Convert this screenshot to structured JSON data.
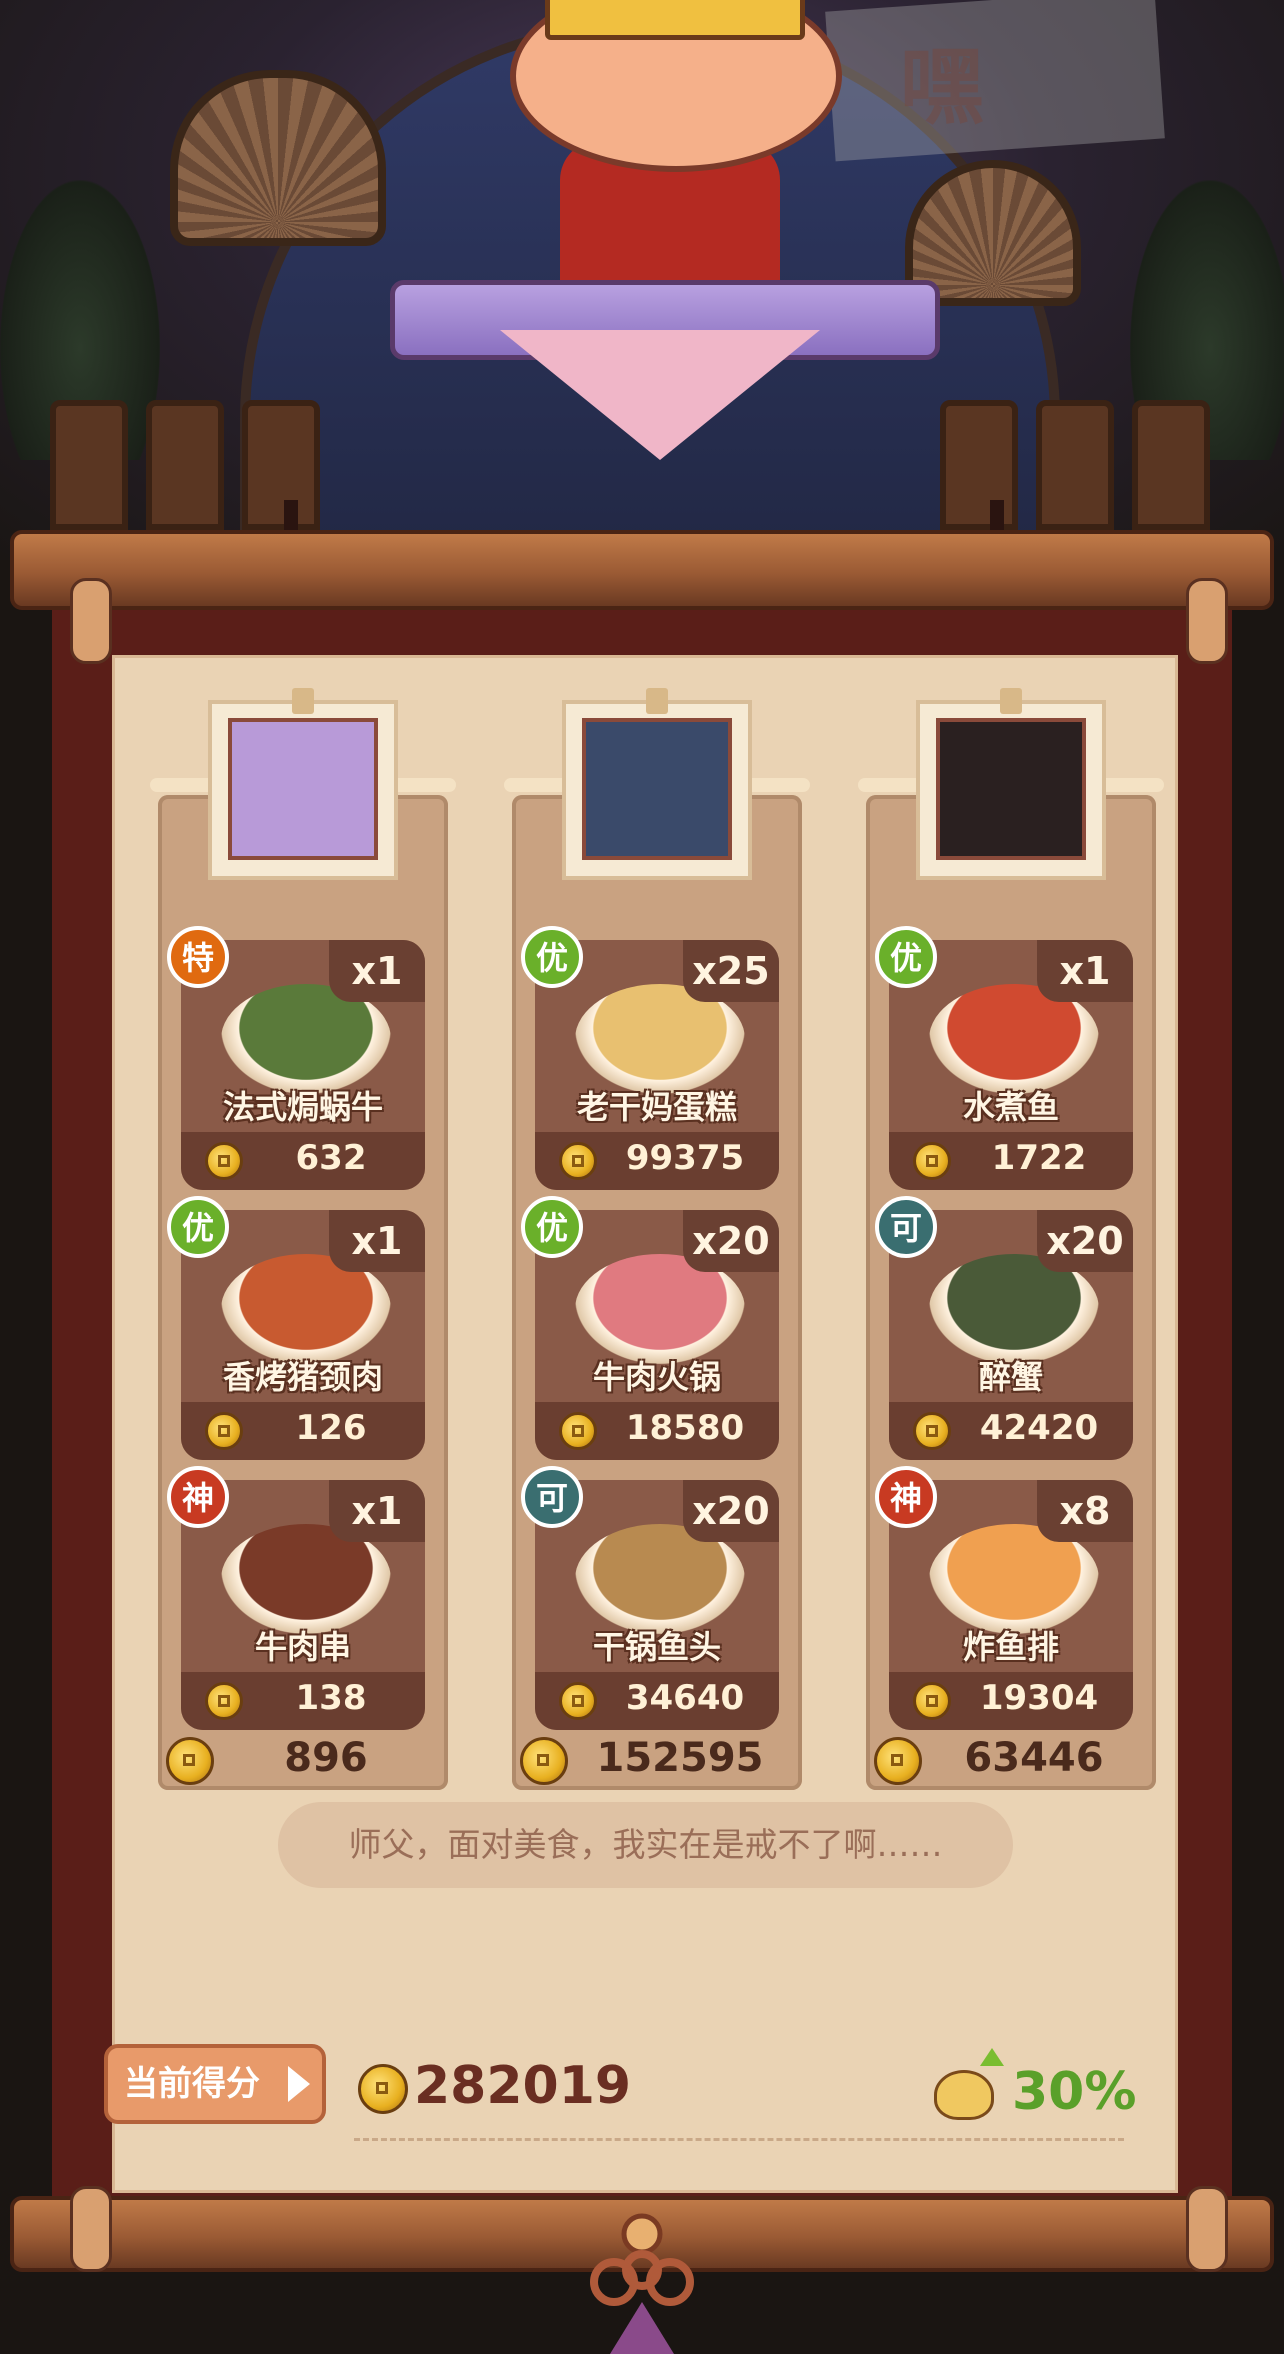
{
  "scene": {
    "sign_text": "嘿"
  },
  "columns": [
    {
      "portrait": "purple-haired-girl",
      "total": "896",
      "dishes": [
        {
          "grade": "特",
          "name": "法式焗蜗牛",
          "qty": "x1",
          "price": "632",
          "color": "#5a7a3a"
        },
        {
          "grade": "优",
          "name": "香烤猪颈肉",
          "qty": "x1",
          "price": "126",
          "color": "#c85a30"
        },
        {
          "grade": "神",
          "name": "牛肉串",
          "qty": "x1",
          "price": "138",
          "color": "#7a3a28"
        }
      ]
    },
    {
      "portrait": "dark-haired-girl",
      "total": "152595",
      "dishes": [
        {
          "grade": "优",
          "name": "老干妈蛋糕",
          "qty": "x25",
          "price": "99375",
          "color": "#e8c070"
        },
        {
          "grade": "优",
          "name": "牛肉火锅",
          "qty": "x20",
          "price": "18580",
          "color": "#e07a80"
        },
        {
          "grade": "可",
          "name": "干锅鱼头",
          "qty": "x20",
          "price": "34640",
          "color": "#b88a50"
        }
      ]
    },
    {
      "portrait": "black-dog",
      "total": "63446",
      "dishes": [
        {
          "grade": "优",
          "name": "水煮鱼",
          "qty": "x1",
          "price": "1722",
          "color": "#d04a30"
        },
        {
          "grade": "可",
          "name": "醉蟹",
          "qty": "x20",
          "price": "42420",
          "color": "#4a5a38"
        },
        {
          "grade": "神",
          "name": "炸鱼排",
          "qty": "x8",
          "price": "19304",
          "color": "#f0a050"
        }
      ]
    }
  ],
  "quote": "师父，面对美食，我实在是戒不了啊……",
  "score": {
    "label": "当前得分",
    "value": "282019",
    "bonus": "30%"
  },
  "colors": {
    "parchment": "#ead3b4",
    "frame": "#5a1e18",
    "accent_green": "#5aa02a",
    "score_text": "#6a2e22"
  }
}
